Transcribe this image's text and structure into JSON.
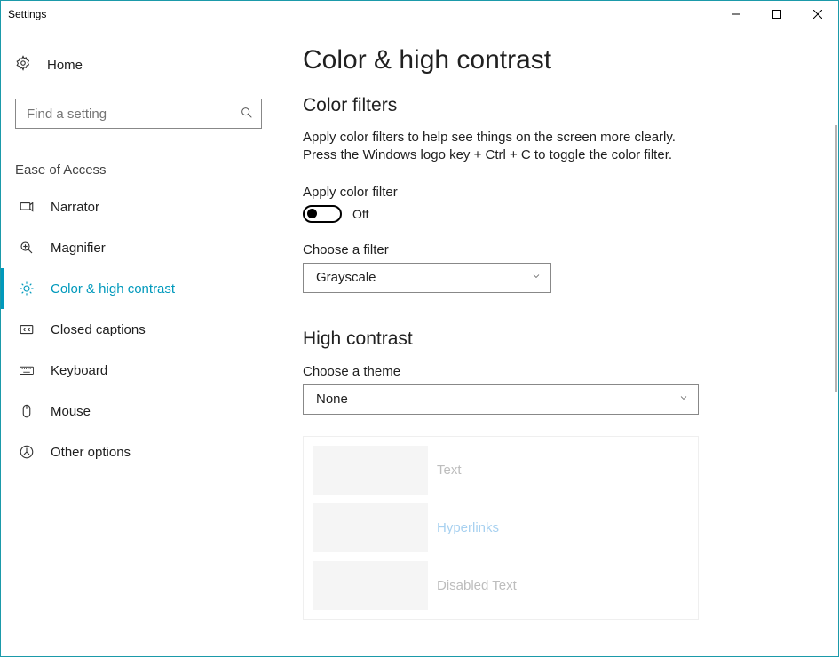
{
  "window": {
    "title": "Settings"
  },
  "home": {
    "label": "Home"
  },
  "search": {
    "placeholder": "Find a setting"
  },
  "category": {
    "label": "Ease of Access"
  },
  "nav": [
    {
      "id": "narrator",
      "label": "Narrator"
    },
    {
      "id": "magnifier",
      "label": "Magnifier"
    },
    {
      "id": "color-contrast",
      "label": "Color & high contrast"
    },
    {
      "id": "closed-captions",
      "label": "Closed captions"
    },
    {
      "id": "keyboard",
      "label": "Keyboard"
    },
    {
      "id": "mouse",
      "label": "Mouse"
    },
    {
      "id": "other",
      "label": "Other options"
    }
  ],
  "page": {
    "title": "Color & high contrast",
    "colorFilters": {
      "heading": "Color filters",
      "description": "Apply color filters to help see things on the screen more clearly. Press the Windows logo key + Ctrl + C to toggle the color filter.",
      "toggleLabel": "Apply color filter",
      "toggleState": "Off",
      "chooseFilterLabel": "Choose a filter",
      "chooseFilterValue": "Grayscale"
    },
    "highContrast": {
      "heading": "High contrast",
      "chooseThemeLabel": "Choose a theme",
      "chooseThemeValue": "None",
      "preview": {
        "text": "Text",
        "hyperlinks": "Hyperlinks",
        "disabled": "Disabled Text"
      }
    }
  },
  "colors": {
    "accent": "#0099bc"
  }
}
